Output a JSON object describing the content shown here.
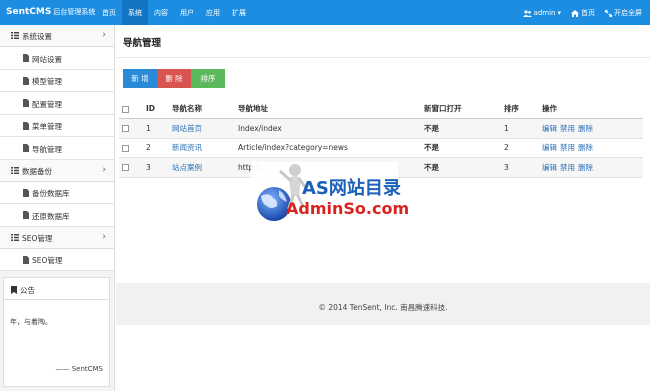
{
  "brand": {
    "name": "SentCMS",
    "subtitle": "后台管理系统"
  },
  "topnav": {
    "items": [
      "首页",
      "系统",
      "内容",
      "用户",
      "应用",
      "扩展"
    ],
    "active_index": 1
  },
  "topright": {
    "user": "admin",
    "home": "首页",
    "fullscreen": "开启全屏"
  },
  "sidebar": {
    "groups": [
      {
        "label": "系统设置",
        "items": [
          "网站设置",
          "模型管理",
          "配置管理",
          "菜单管理",
          "导航管理"
        ]
      },
      {
        "label": "数据备份",
        "items": [
          "备份数据库",
          "还原数据库"
        ]
      },
      {
        "label": "SEO管理",
        "items": [
          "SEO管理"
        ]
      }
    ],
    "notice": {
      "title": "公告",
      "body": "年，与着陶。",
      "sign": "—— SentCMS"
    }
  },
  "main": {
    "title": "导航管理",
    "buttons": {
      "add": "新 增",
      "delete": "删 除",
      "sort": "排序"
    },
    "table": {
      "headers": {
        "id": "ID",
        "name": "导航名称",
        "url": "导航地址",
        "newwin": "新窗口打开",
        "sort": "排序",
        "actions": "操作"
      },
      "rows": [
        {
          "id": "1",
          "name": "网站首页",
          "url": "Index/index",
          "newwin": "不是",
          "sort": "1"
        },
        {
          "id": "2",
          "name": "新闻资讯",
          "url": "Article/index?category=news",
          "newwin": "不是",
          "sort": "2"
        },
        {
          "id": "3",
          "name": "站点案例",
          "url": "http://...",
          "newwin": "不是",
          "sort": "3"
        }
      ],
      "actions": {
        "edit": "编辑",
        "disable": "禁用",
        "delete": "删除"
      }
    },
    "footer": "© 2014 TenSent, Inc. 南昌腾速科技."
  },
  "watermark": {
    "line1": "AS网站目录",
    "line2": "AdminSo.com"
  },
  "colors": {
    "topbar": "#1c8de0",
    "active_nav": "#1276c5",
    "add": "#2b8ad6",
    "delete": "#d9534f",
    "sort": "#5cb85c",
    "link": "#2a6fb5"
  }
}
